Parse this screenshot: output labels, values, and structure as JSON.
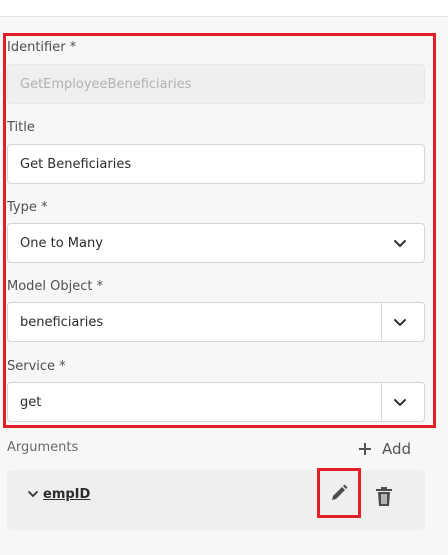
{
  "form": {
    "identifier": {
      "label": "Identifier *",
      "value": "GetEmployeeBeneficiaries"
    },
    "title": {
      "label": "Title",
      "value": "Get Beneficiaries"
    },
    "type": {
      "label": "Type *",
      "value": "One to Many",
      "icon": "chevron-down-icon"
    },
    "model_object": {
      "label": "Model Object *",
      "value": "beneficiaries",
      "icon": "chevron-down-icon"
    },
    "service": {
      "label": "Service *",
      "value": "get",
      "icon": "chevron-down-icon"
    }
  },
  "arguments": {
    "label": "Arguments",
    "add_label": "Add",
    "add_icon": "plus-icon",
    "items": [
      {
        "name": "empID",
        "expand_icon": "chevron-down-icon",
        "edit_icon": "pencil-icon",
        "delete_icon": "trash-icon"
      }
    ]
  },
  "colors": {
    "highlight": "#e41e26",
    "background": "#f7f7f7",
    "field_background": "#ffffff",
    "disabled_background": "#efefef"
  }
}
